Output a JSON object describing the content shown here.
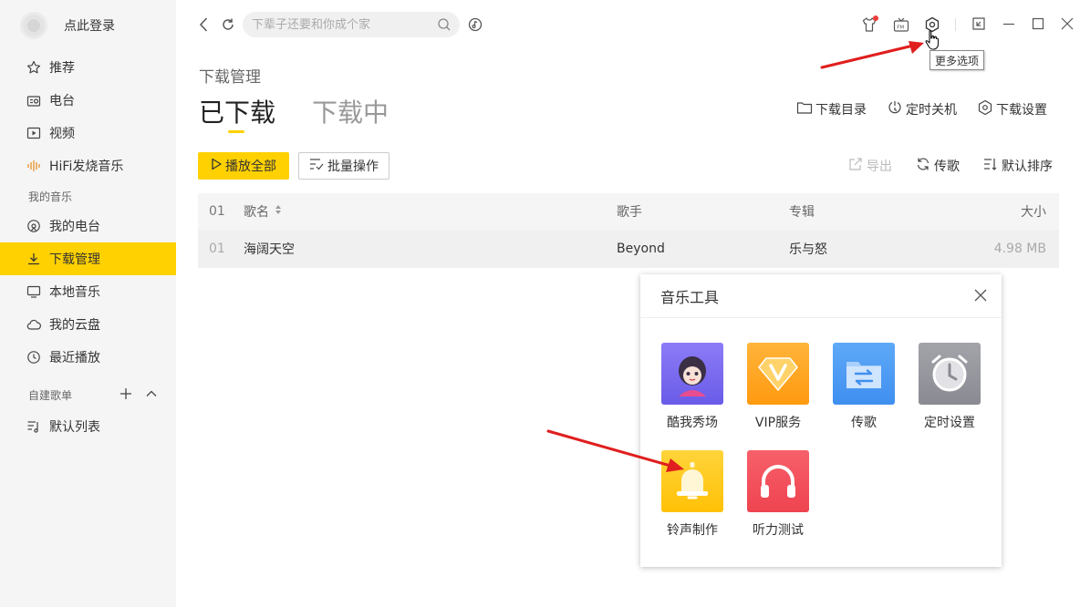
{
  "sidebar": {
    "login_text": "点此登录",
    "items": [
      {
        "label": "推荐",
        "icon": "star-icon"
      },
      {
        "label": "电台",
        "icon": "radio-icon"
      },
      {
        "label": "视频",
        "icon": "video-icon"
      },
      {
        "label": "HiFi发烧音乐",
        "icon": "hifi-wave-icon"
      }
    ],
    "section_my_music": "我的音乐",
    "my_items": [
      {
        "label": "我的电台",
        "icon": "my-radio-icon"
      },
      {
        "label": "下载管理",
        "icon": "download-icon",
        "active": true
      },
      {
        "label": "本地音乐",
        "icon": "monitor-icon"
      },
      {
        "label": "我的云盘",
        "icon": "cloud-icon"
      },
      {
        "label": "最近播放",
        "icon": "clock-icon"
      }
    ],
    "section_playlists": "自建歌单",
    "playlist_items": [
      {
        "label": "默认列表",
        "icon": "playlist-icon"
      }
    ]
  },
  "topbar": {
    "search_placeholder": "下辈子还要和你成个家",
    "tooltip": "更多选项"
  },
  "main": {
    "page_title": "下载管理",
    "tabs": [
      {
        "label": "已下载",
        "active": true
      },
      {
        "label": "下载中",
        "active": false
      }
    ],
    "top_actions": [
      {
        "label": "下载目录",
        "icon": "folder-icon"
      },
      {
        "label": "定时关机",
        "icon": "timer-power-icon"
      },
      {
        "label": "下载设置",
        "icon": "settings-hex-icon"
      }
    ],
    "play_all": "播放全部",
    "batch": "批量操作",
    "row_actions": [
      {
        "label": "导出",
        "icon": "export-icon",
        "disabled": true
      },
      {
        "label": "传歌",
        "icon": "sync-icon"
      },
      {
        "label": "默认排序",
        "icon": "sort-icon"
      }
    ],
    "table": {
      "headers": {
        "idx": "01",
        "name": "歌名",
        "artist": "歌手",
        "album": "专辑",
        "size": "大小"
      },
      "rows": [
        {
          "idx": "01",
          "name": "海阔天空",
          "artist": "Beyond",
          "album": "乐与怒",
          "size": "4.98 MB"
        }
      ]
    }
  },
  "dialog": {
    "title": "音乐工具",
    "tools": [
      {
        "label": "酷我秀场",
        "color": "#7b6cf0"
      },
      {
        "label": "VIP服务",
        "color": "#ffa51f"
      },
      {
        "label": "传歌",
        "color": "#4d9ef5"
      },
      {
        "label": "定时设置",
        "color": "#9a9aa2"
      },
      {
        "label": "铃声制作",
        "color": "#ffcc1a"
      },
      {
        "label": "听力测试",
        "color": "#f2535c"
      }
    ]
  }
}
